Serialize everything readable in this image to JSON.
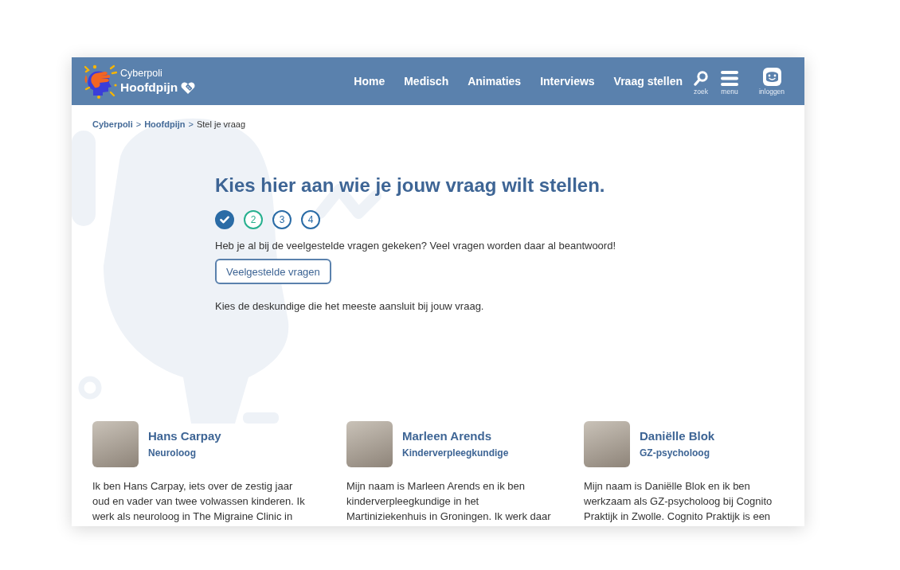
{
  "header": {
    "brand": {
      "site": "Cyberpoli",
      "section": "Hoofdpijn"
    },
    "nav": [
      {
        "label": "Home"
      },
      {
        "label": "Medisch"
      },
      {
        "label": "Animaties"
      },
      {
        "label": "Interviews"
      },
      {
        "label": "Vraag stellen"
      }
    ],
    "tools": [
      {
        "kind": "search",
        "label": "zoek"
      },
      {
        "kind": "menu",
        "label": "menu"
      },
      {
        "kind": "login",
        "label": "inloggen"
      }
    ]
  },
  "breadcrumb": [
    {
      "label": "Cyberpoli",
      "separator": ">",
      "current": false
    },
    {
      "label": "Hoofdpijn",
      "separator": ">",
      "current": false
    },
    {
      "label": "Stel je vraag",
      "current": true
    }
  ],
  "intro": {
    "title": "Kies hier aan wie je jouw vraag wilt stellen.",
    "steps": [
      {
        "completed": true,
        "selected": false
      },
      {
        "label": "2",
        "completed": false,
        "selected": true
      },
      {
        "label": "3",
        "completed": false,
        "selected": false
      },
      {
        "label": "4",
        "completed": false,
        "selected": false
      }
    ],
    "faq_text": "Heb je al bij de veelgestelde vragen gekeken? Veel vragen worden daar al beantwoord!",
    "faq_button": "Veelgestelde vragen",
    "choose_text": "Kies de deskundige die het meeste aansluit bij jouw vraag."
  },
  "experts": [
    {
      "name": "Hans Carpay",
      "role": "Neuroloog",
      "bio": "Ik ben Hans Carpay, iets over de zestig jaar oud en vader van twee volwassen kinderen. Ik werk als neuroloog in The Migraine Clinic in"
    },
    {
      "name": "Marleen Arends",
      "role": "Kinderverpleegkundige",
      "bio": "Mijn naam is Marleen Arends en ik ben kinderverpleegkundige in het Martiniziekenhuis in Groningen. Ik werk daar"
    },
    {
      "name": "Daniëlle Blok",
      "role": "GZ-psycholoog",
      "bio": "Mijn naam is Daniëlle Blok en ik ben werkzaam als GZ-psycholoog bij Cognito Praktijk in Zwolle. Cognito Praktijk is een"
    }
  ]
}
